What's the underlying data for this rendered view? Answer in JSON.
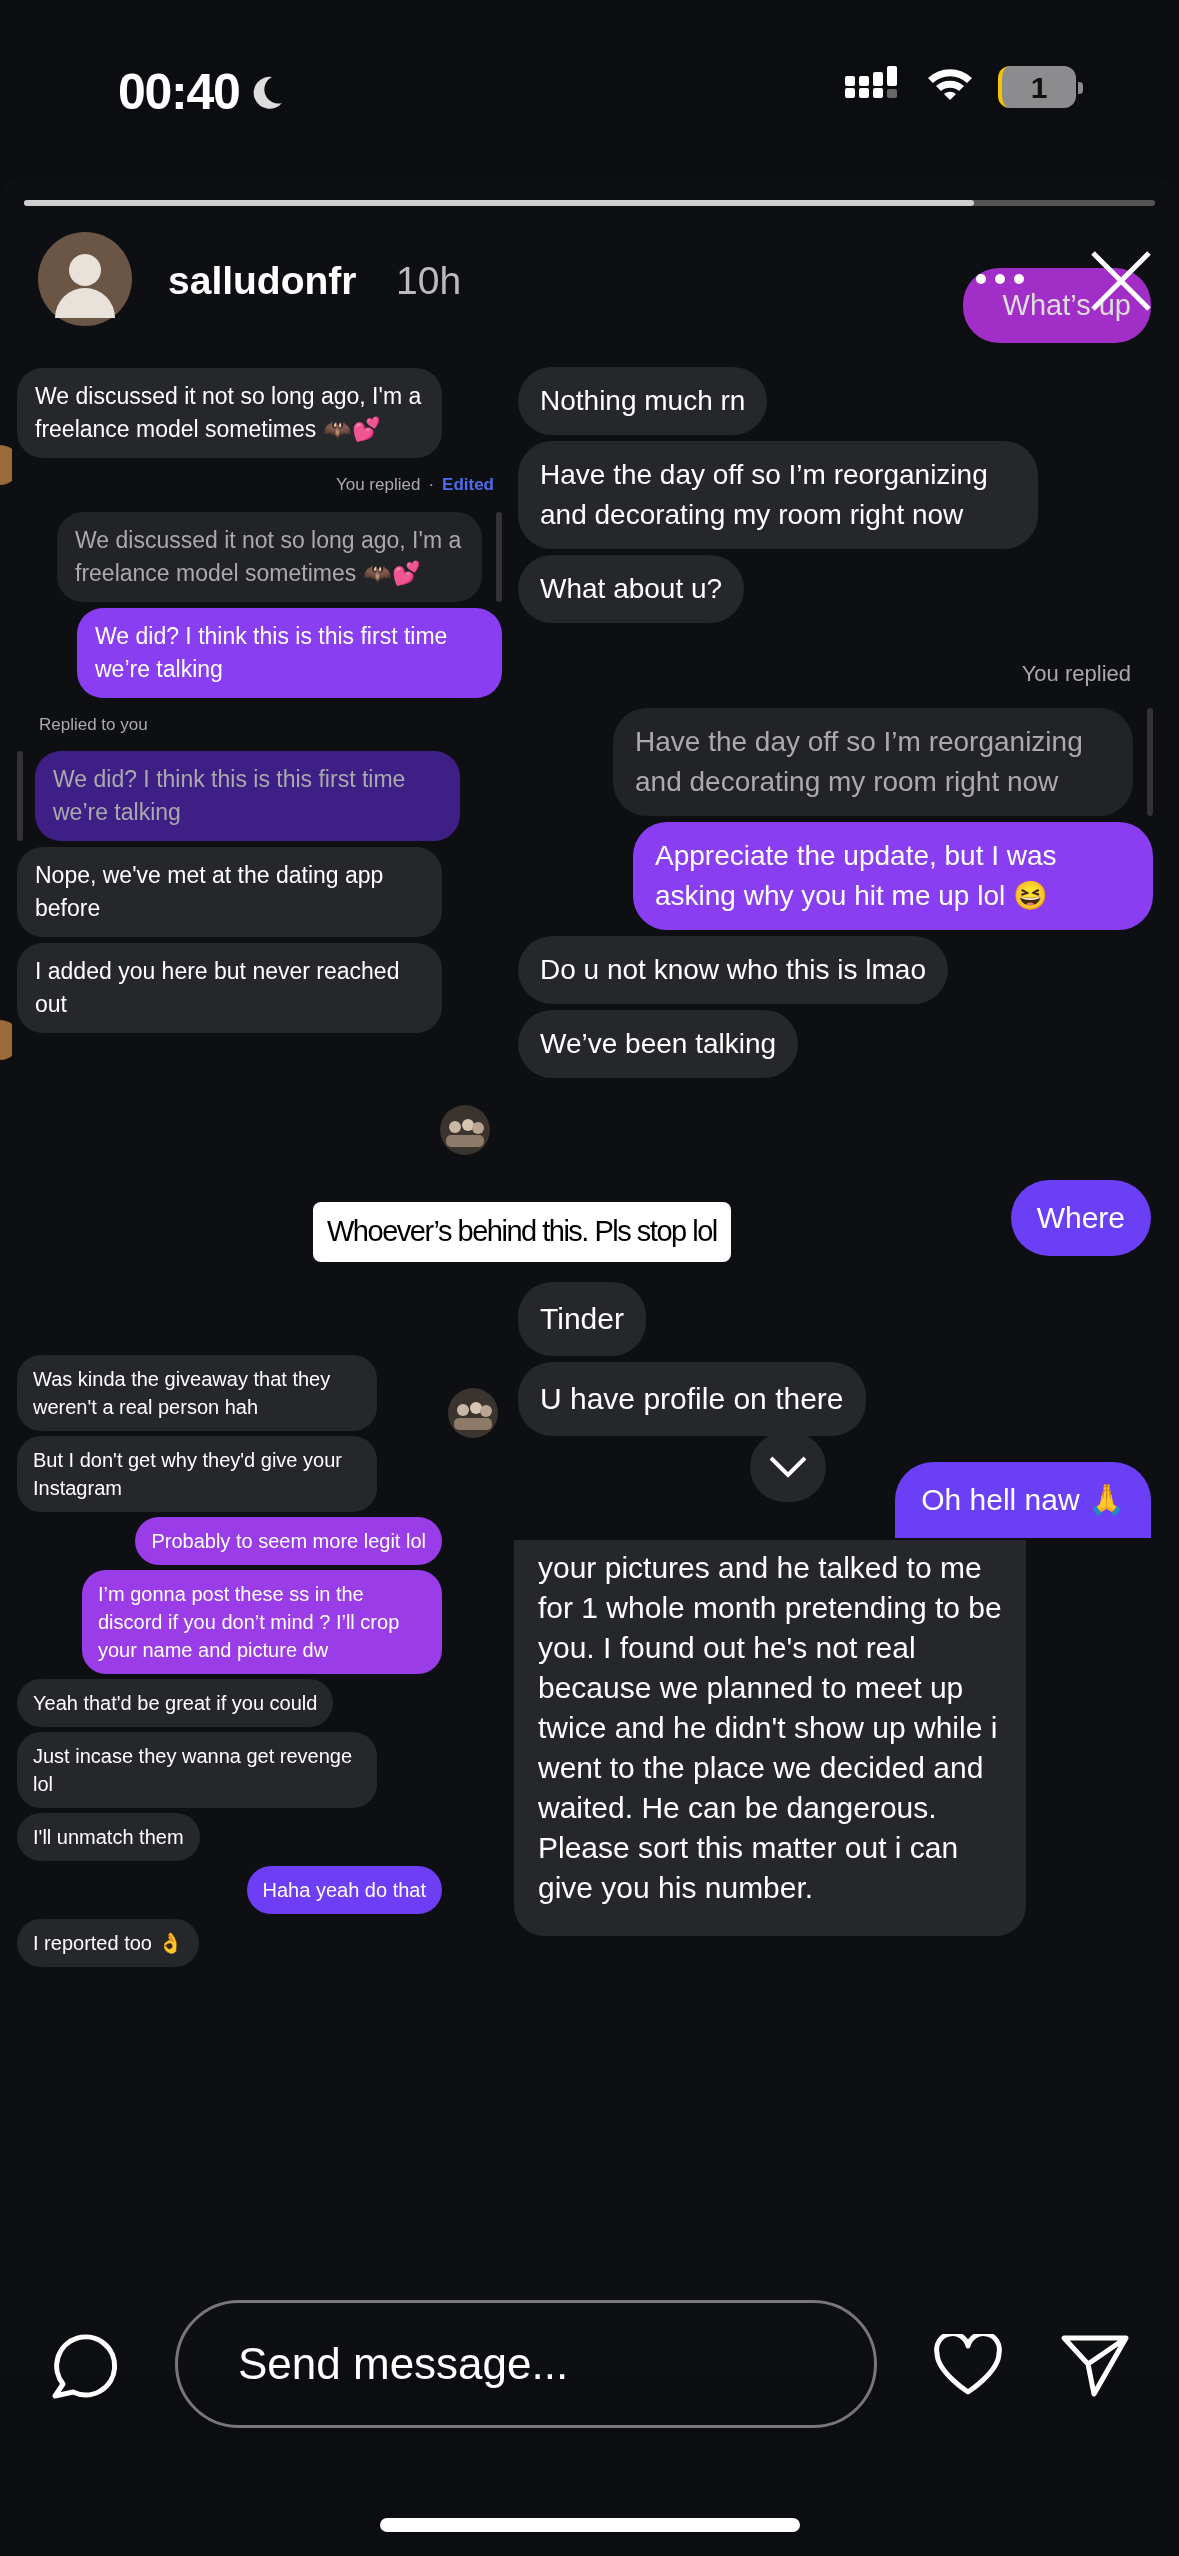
{
  "status_bar": {
    "time": "00:40",
    "battery": "1"
  },
  "story_header": {
    "username": "salludonfr",
    "time_ago": "10h",
    "progress": {
      "level": 0.84
    }
  },
  "corner_bubble": {
    "text": "What’s up",
    "color": "#a22ec8"
  },
  "collage": {
    "panels": [
      {
        "messages": [
          {
            "kind": "received",
            "text": "We discussed it not so long ago, I'm a freelance model sometimes 🦇💕"
          },
          {
            "kind": "note",
            "outgoing": true,
            "text": "You replied",
            "separator": "·",
            "tag": "Edited"
          },
          {
            "kind": "yourquote",
            "color": "#222327",
            "text": "We discussed it not so long ago, I'm a freelance model sometimes 🦇💕"
          },
          {
            "kind": "sent",
            "color": "#8a3ef2",
            "text": "We did? I think this is this first time we’re talking"
          },
          {
            "kind": "note",
            "outgoing": false,
            "text": "Replied to you"
          },
          {
            "kind": "theirquote",
            "color": "#3d1f86",
            "text": "We did? I think this is this first time we’re talking"
          },
          {
            "kind": "received",
            "text": "Nope, we've met at the dating app before"
          },
          {
            "kind": "received",
            "text": "I added you here but never reached out"
          }
        ]
      },
      {
        "messages": [
          {
            "kind": "received",
            "text": "Nothing much rn"
          },
          {
            "kind": "received",
            "text": "Have the day off so I’m reorganizing and decorating my room right now"
          },
          {
            "kind": "received",
            "text": "What about u?"
          },
          {
            "kind": "note",
            "outgoing": true,
            "text": "You replied"
          },
          {
            "kind": "yourquote",
            "color": "#222327",
            "text": "Have the day off so I’m reorganizing and decorating my room right now"
          },
          {
            "kind": "sent",
            "color": "#8a3ef2",
            "text": "Appreciate the update, but I was asking why you hit me up lol 😆"
          },
          {
            "kind": "received",
            "text": "Do u not know who this is lmao"
          },
          {
            "kind": "received",
            "text": "We’ve been talking"
          }
        ]
      },
      {
        "messages": [
          {
            "kind": "received",
            "text": "Tinder"
          },
          {
            "kind": "received",
            "text": "U have profile on there"
          }
        ]
      },
      {
        "messages": [
          {
            "kind": "received",
            "text": "Was kinda the giveaway that they weren't a real person hah"
          },
          {
            "kind": "received",
            "text": "But I don't get why they'd give your Instagram"
          },
          {
            "kind": "sent",
            "color": "#9a3de8",
            "text": "Probably to seem more legit lol"
          },
          {
            "kind": "sent",
            "color": "#9a3de8",
            "text": "I’m gonna post these ss in the discord if you don’t mind ? I’ll crop your name and picture dw"
          },
          {
            "kind": "received",
            "text": "Yeah that'd be great if you could"
          },
          {
            "kind": "received",
            "text": "Just incase they wanna get revenge lol"
          },
          {
            "kind": "received",
            "text": "I'll unmatch them"
          },
          {
            "kind": "sent",
            "color": "#6d3ef5",
            "text": "Haha yeah do that"
          },
          {
            "kind": "received",
            "text": "I reported too 👌"
          }
        ]
      },
      {
        "messages": [
          {
            "kind": "received",
            "text": "your pictures and he talked to me\nfor 1 whole month pretending to be\nyou. I found out he's not real\nbecause we planned to meet up\ntwice and he didn't show up while i\nwent to the place we decided and\nwaited. He can be dangerous.\nPlease sort this matter out i can\ngive you his number."
          }
        ]
      }
    ],
    "sticker": "Whoever’s behind this. Pls stop lol",
    "loose_messages": [
      {
        "kind": "sent",
        "color": "#6a3ff5",
        "text": "Where"
      },
      {
        "kind": "sent",
        "color": "#6a3ff5",
        "text": "Oh hell naw 🙏"
      }
    ]
  },
  "composer": {
    "placeholder": "Send message..."
  }
}
